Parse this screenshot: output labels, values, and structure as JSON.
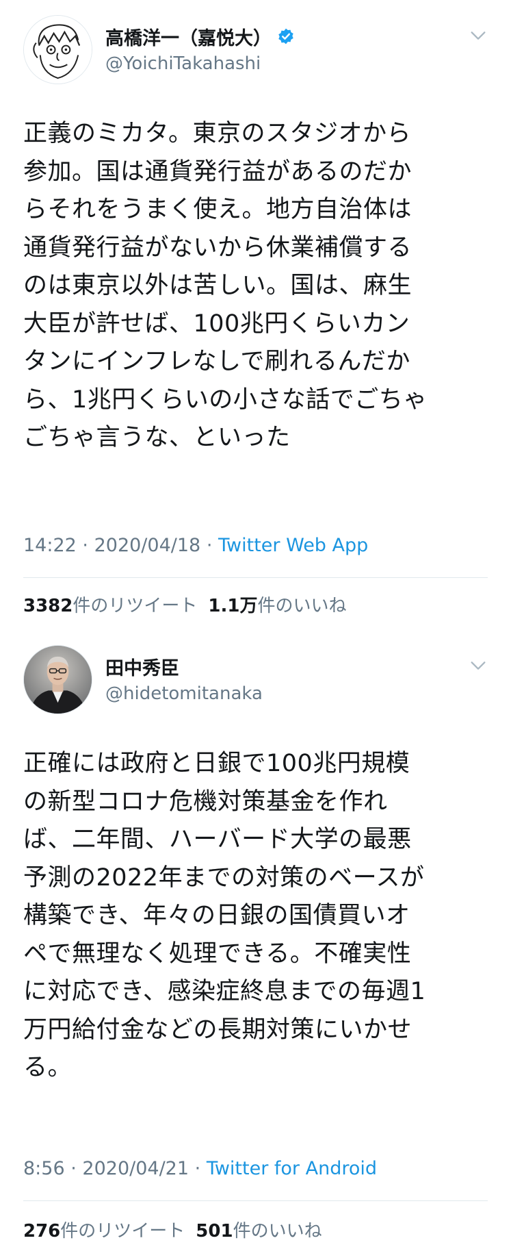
{
  "tweets": [
    {
      "display_name": "高橋洋一（嘉悦大）",
      "verified": true,
      "handle": "@YoichiTakahashi",
      "text": "正義のミカタ。東京のスタジオから\n参加。国は通貨発行益があるのだか\nらそれをうまく使え。地方自治体は\n通貨発行益がないから休業補償する\nのは東京以外は苦しい。国は、麻生\n大臣が許せば、100兆円くらいカン\nタンにインフレなしで刷れるんだか\nら、1兆円くらいの小さな話でごちゃ\nごちゃ言うな、といった",
      "time": "14:22",
      "separator": "·",
      "date": "2020/04/18",
      "source": "Twitter Web App",
      "retweet_count": "3382",
      "retweet_label": "件のリツイート",
      "like_count": "1.1万",
      "like_label": "件のいいね"
    },
    {
      "display_name": "田中秀臣",
      "verified": false,
      "handle": "@hidetomitanaka",
      "text": "正確には政府と日銀で100兆円規模\nの新型コロナ危機対策基金を作れ\nば、二年間、ハーバード大学の最悪\n予測の2022年までの対策のベースが\n構築でき、年々の日銀の国債買いオ\nペで無理なく処理できる。不確実性\nに対応でき、感染症終息までの毎週1\n万円給付金などの長期対策にいかせ\nる。",
      "time": "8:56",
      "separator": "·",
      "date": "2020/04/21",
      "source": "Twitter for Android",
      "retweet_count": "276",
      "retweet_label": "件のリツイート",
      "like_count": "501",
      "like_label": "件のいいね"
    }
  ],
  "colors": {
    "text": "#14171a",
    "secondary": "#657786",
    "link": "#1b95e0",
    "verified": "#1da1f2",
    "divider": "#e1e8ed"
  },
  "icons": {
    "verified": "verified-badge-icon",
    "menu": "chevron-down-icon"
  }
}
